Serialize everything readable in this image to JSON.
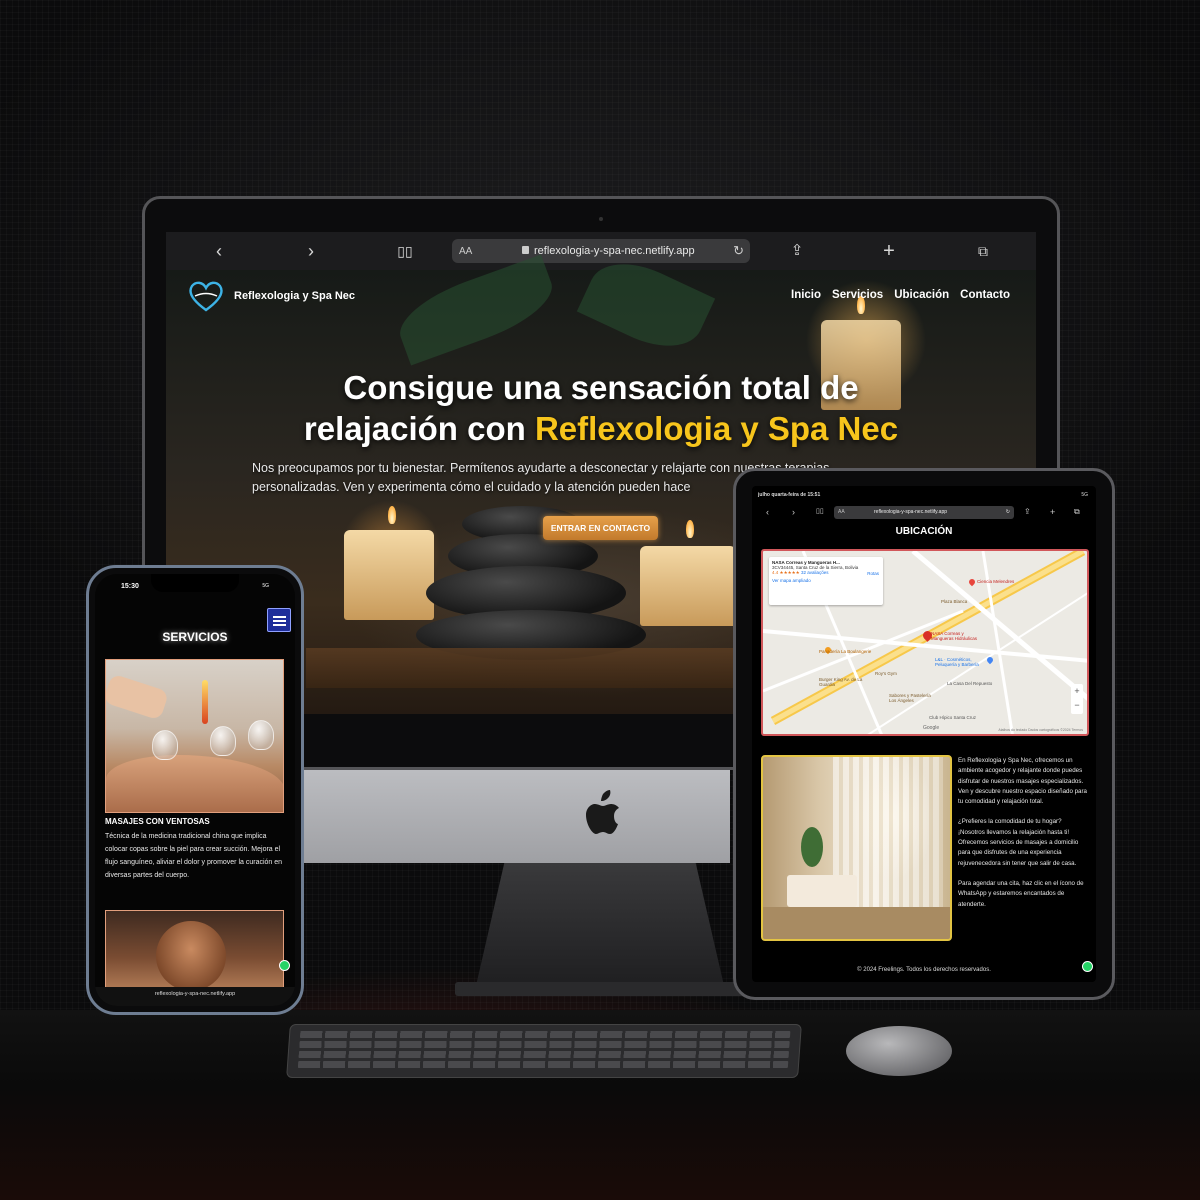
{
  "desktop": {
    "browser": {
      "url": "reflexologia-y-spa-nec.netlify.app",
      "text_size_label": "AA",
      "back_icon": "chevron-left-icon",
      "forward_icon": "chevron-right-icon"
    },
    "nav": {
      "brand": "Reflexologia y Spa Nec",
      "links": [
        "Inicio",
        "Servicios",
        "Ubicación",
        "Contacto"
      ]
    },
    "hero": {
      "title_part1": "Consigue una sensación total de",
      "title_part2": "relajación con",
      "title_highlight": "Reflexologia y Spa Nec",
      "text_line1": "Nos preocupamos por tu bienestar. Permítenos ayudarte a desconectar y relajarte con nuestras terapias",
      "text_line2": "personalizadas. Ven y experimenta cómo el cuidado y la atención pueden hace",
      "cta_label": "ENTRAR EN CONTACTO"
    }
  },
  "tablet": {
    "status": "julho quarta-feira de 15:51",
    "signal": "5G",
    "url": "reflexologia-y-spa-nec.netlify.app",
    "text_size_label": "AA",
    "section_title": "UBICACIÓN",
    "map": {
      "place_name": "NASA Correas y Mangueras H...",
      "address": "3CV34445, Santa Cruz de la Sierra, Bolivia",
      "rating": "4.4",
      "stars": "★★★★★",
      "reviews": "32 avaliações",
      "enlarge_link": "Ver mapa ampliado",
      "directions": "Rotas",
      "labels": [
        "Ciencia Melendres",
        "Plaza Blanca",
        "Panadería La Boulangerie",
        "NASA Correas y Mangueras Hidráulicas",
        "L&L · Cosméticos, Peluquería y Barbería",
        "Burger King Av. de La Guardia",
        "Roy's Gym",
        "La Casa Del Repuesto",
        "Sabores y Pastelería Los Ángeles",
        "Club Hípico Santa Cruz"
      ],
      "google": "Google",
      "footer": "Atalhos do teclado   Dados cartográficos ©2024   Termos"
    },
    "paragraphs": [
      "En Reflexologia y Spa Nec, ofrecemos un ambiente acogedor y relajante donde puedes disfrutar de nuestros masajes especializados. Ven y descubre nuestro espacio diseñado para tu comodidad y relajación total.",
      "¿Prefieres la comodidad de tu hogar? ¡Nosotros llevamos la relajación hasta ti! Ofrecemos servicios de masajes a domicilio para que disfrutes de una experiencia rejuvenecedora sin tener que salir de casa.",
      "Para agendar una cita, haz clic en el ícono de WhatsApp y estaremos encantados de atenderte."
    ],
    "footer": "© 2024 Freelings. Todos los derechos reservados."
  },
  "phone": {
    "time": "15:30",
    "signal": "5G",
    "section_title": "SERVICIOS",
    "service_title": "MASAJES CON VENTOSAS",
    "service_desc": "Técnica de la medicina tradicional china que implica colocar copas sobre la piel para crear succión. Mejora el flujo sanguíneo, aliviar el dolor y promover la curación en diversas partes del cuerpo.",
    "url": "reflexologia-y-spa-nec.netlify.app"
  },
  "colors": {
    "highlight": "#f7c51c",
    "cta": "#d68a3a",
    "menu_button": "#1f2e9a",
    "whatsapp": "#25d366"
  }
}
